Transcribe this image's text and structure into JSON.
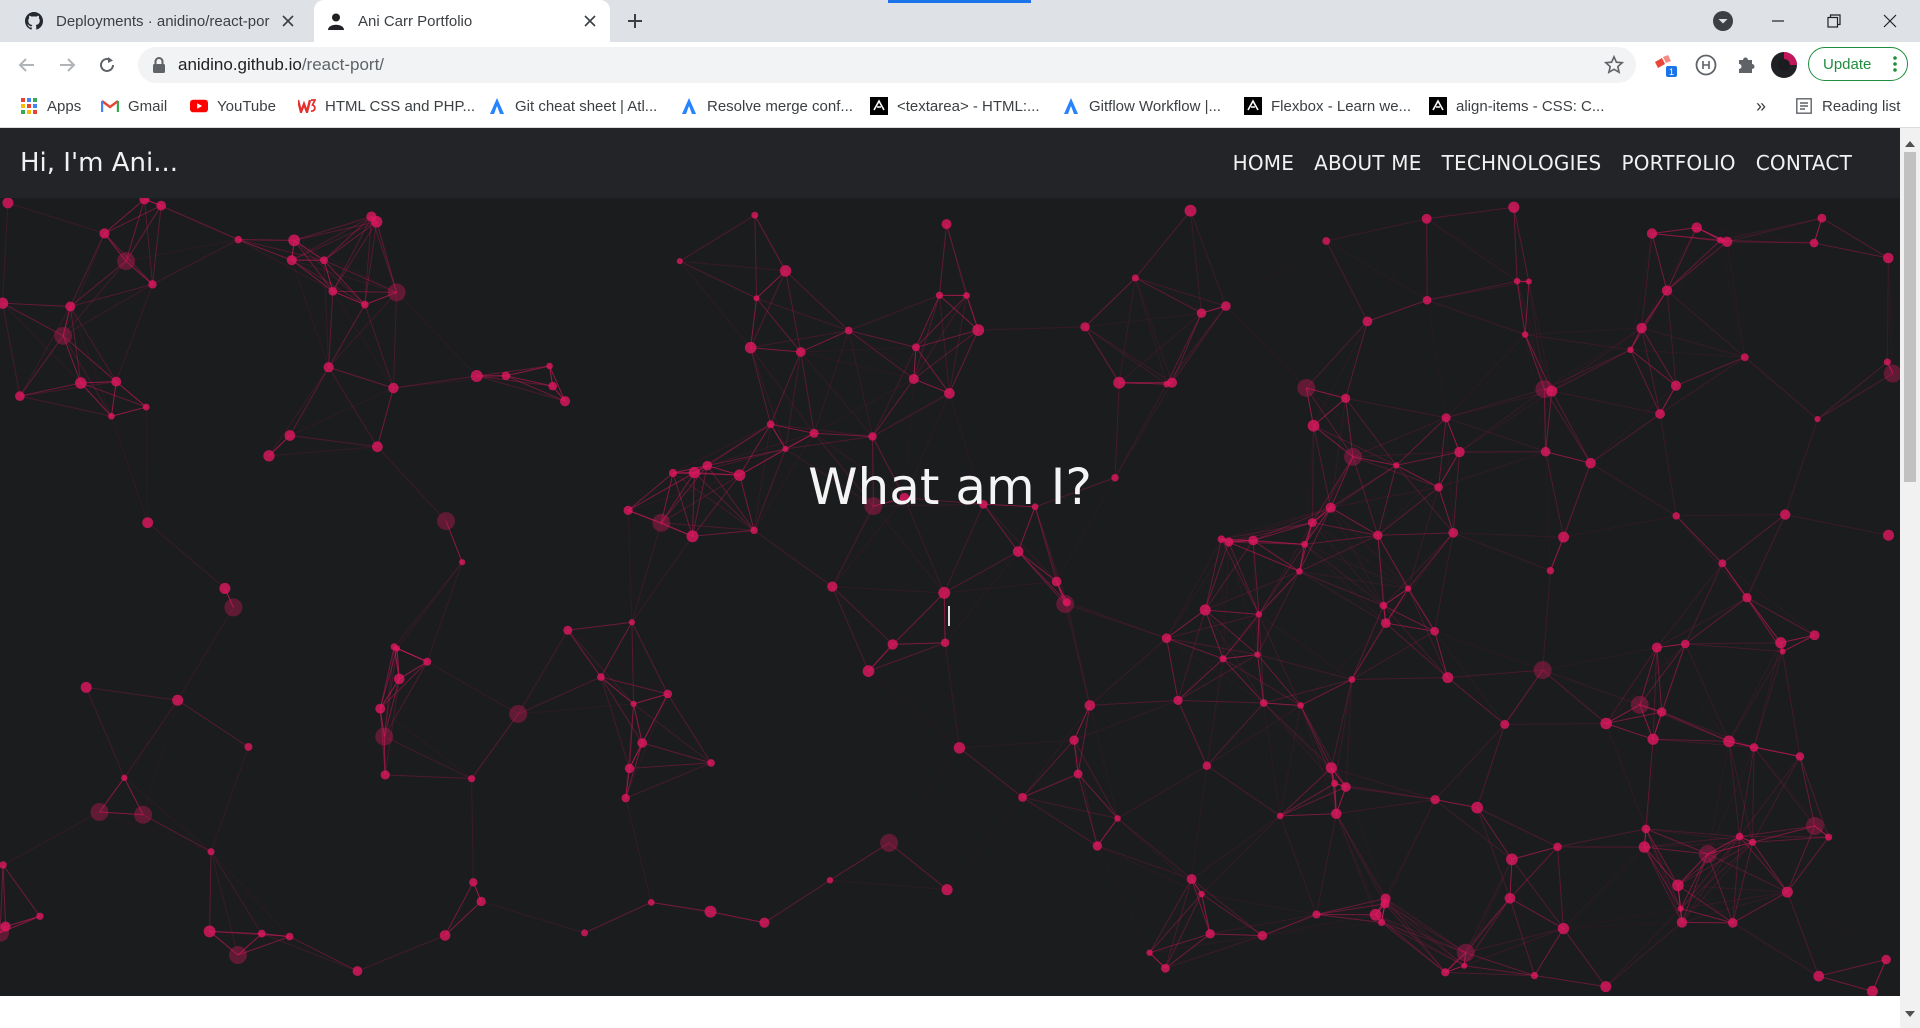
{
  "browser": {
    "tabs": [
      {
        "title": "Deployments · anidino/react-por",
        "active": false,
        "icon": "github-icon"
      },
      {
        "title": "Ani Carr Portfolio",
        "active": true,
        "icon": "person-icon"
      }
    ],
    "url_domain": "anidino.github.io",
    "url_path": "/react-port/",
    "update_label": "Update",
    "extension_badge": "1",
    "bookmarks": [
      {
        "label": "Apps",
        "icon": "apps-grid-icon"
      },
      {
        "label": "Gmail",
        "icon": "gmail-icon"
      },
      {
        "label": "YouTube",
        "icon": "youtube-icon"
      },
      {
        "label": "HTML CSS and PHP...",
        "icon": "w3-icon"
      },
      {
        "label": "Git cheat sheet | Atl...",
        "icon": "atlassian-icon"
      },
      {
        "label": "Resolve merge conf...",
        "icon": "atlassian-icon"
      },
      {
        "label": "<textarea> - HTML:...",
        "icon": "mdn-icon"
      },
      {
        "label": "Gitflow Workflow |...",
        "icon": "atlassian-icon"
      },
      {
        "label": "Flexbox - Learn we...",
        "icon": "mdn-icon"
      },
      {
        "label": "align-items - CSS: C...",
        "icon": "mdn-icon"
      }
    ],
    "bookmarks_overflow": "»",
    "reading_list": "Reading list"
  },
  "site": {
    "brand": "Hi, I'm Ani...",
    "nav": [
      "HOME",
      "ABOUT ME",
      "TECHNOLOGIES",
      "PORTFOLIO",
      "CONTACT"
    ],
    "hero_title": "What am I?",
    "background_color": "#1b1c1e",
    "accent_color": "#e0185f"
  }
}
